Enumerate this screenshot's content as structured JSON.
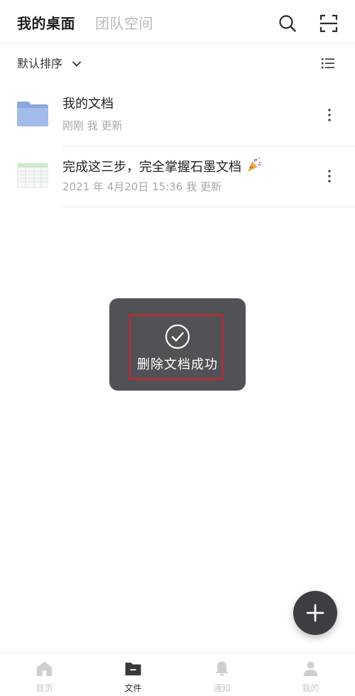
{
  "header": {
    "tabs": [
      {
        "label": "我的桌面",
        "active": true
      },
      {
        "label": "团队空间",
        "active": false
      }
    ],
    "icons": [
      "search-icon",
      "scan-icon"
    ]
  },
  "sortbar": {
    "label": "默认排序",
    "chevron_icon": "chevron-down-icon",
    "view_icon": "list-view-icon"
  },
  "files": [
    {
      "title": "我的文档",
      "meta": "刚刚 我 更新",
      "thumb": "folder-icon"
    },
    {
      "title": "完成这三步，完全掌握石墨文档",
      "meta": "2021 年 4月20日 15:36 我 更新",
      "thumb": "spreadsheet-thumbnail",
      "emoji_icon": "party-popper-icon"
    }
  ],
  "toast": {
    "message": "删除文档成功",
    "icon": "check-circle-icon"
  },
  "fab": {
    "icon": "plus-icon"
  },
  "bottom_nav": {
    "items": [
      {
        "label": "首页",
        "icon": "home-icon",
        "active": false
      },
      {
        "label": "文件",
        "icon": "folder-minus-icon",
        "active": true
      },
      {
        "label": "通知",
        "icon": "bell-icon",
        "active": false
      },
      {
        "label": "我的",
        "icon": "person-icon",
        "active": false
      }
    ]
  },
  "colors": {
    "text_primary": "#222222",
    "text_secondary": "#a8a8a8",
    "tab_inactive": "#b8b8b8",
    "toast_bg": "#525256",
    "highlight_border": "#d2202d",
    "fab_bg": "#3d3d42",
    "folder_blue": "#9bb5e4"
  }
}
